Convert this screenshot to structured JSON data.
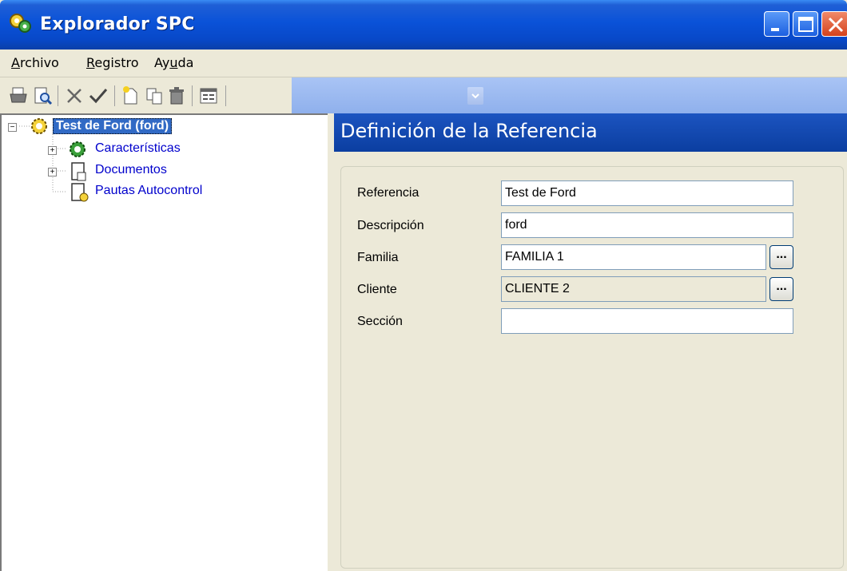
{
  "window": {
    "title": "Explorador SPC",
    "icon": "app-gear-icon"
  },
  "menu": {
    "items": [
      {
        "label_pre": "",
        "label_ul": "A",
        "label_post": "rchivo"
      },
      {
        "label_pre": "",
        "label_ul": "R",
        "label_post": "egistro"
      },
      {
        "label_pre": "Ay",
        "label_ul": "u",
        "label_post": "da"
      }
    ]
  },
  "toolbar": {
    "icons": [
      "print-icon",
      "print-preview-icon",
      "cancel-icon",
      "accept-icon",
      "new-icon",
      "copy-icon",
      "delete-icon",
      "view-form-icon"
    ]
  },
  "tree": {
    "root": {
      "label": "Test de Ford (ford)"
    },
    "children": [
      {
        "label": "Características",
        "expandable": true
      },
      {
        "label": "Documentos",
        "expandable": true
      },
      {
        "label": "Pautas Autocontrol",
        "expandable": false
      }
    ]
  },
  "detail": {
    "header": "Definición de la Referencia",
    "fields": [
      {
        "label": "Referencia",
        "value": "Test de Ford"
      },
      {
        "label": "Descripción",
        "value": "ford"
      },
      {
        "label": "Familia",
        "value": "FAMILIA 1"
      },
      {
        "label": "Cliente",
        "value": "CLIENTE 2"
      },
      {
        "label": "Sección",
        "value": ""
      }
    ],
    "ellipsis_label": "..."
  }
}
